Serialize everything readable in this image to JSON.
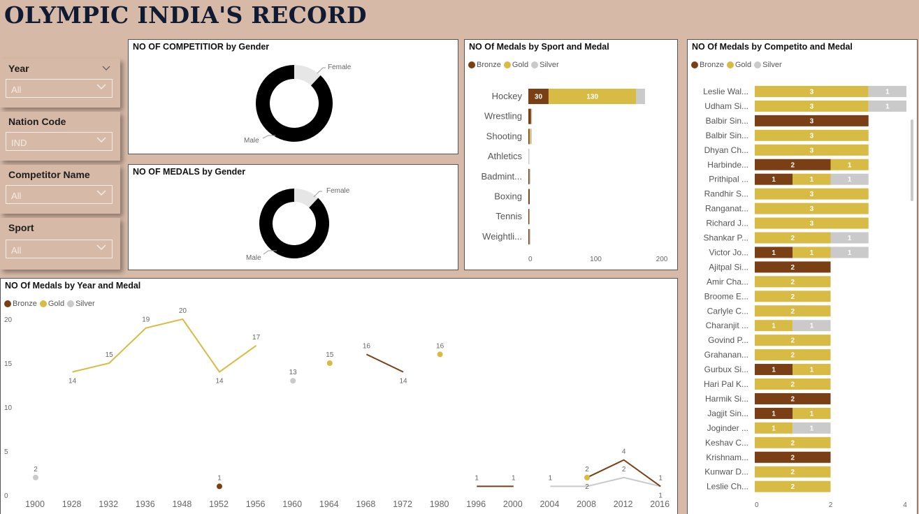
{
  "title": "OLYMPIC INDIA'S RECORD",
  "colors": {
    "bronze": "#7b3f15",
    "gold": "#d7bb45",
    "silver": "#cacaca",
    "male": "#000000",
    "female": "#e6e6e6"
  },
  "slicers": [
    {
      "label": "Year",
      "value": "All"
    },
    {
      "label": "Nation Code",
      "value": "IND"
    },
    {
      "label": "Competitor Name",
      "value": "All"
    },
    {
      "label": "Sport",
      "value": "All"
    }
  ],
  "legend": {
    "bronze": "Bronze",
    "gold": "Gold",
    "silver": "Silver"
  },
  "chart_data": [
    {
      "type": "pie",
      "title": "NO OF COMPETITIOR by Gender",
      "labels": [
        "Male",
        "Female"
      ],
      "values": [
        88,
        12
      ]
    },
    {
      "type": "pie",
      "title": "NO OF MEDALS by Gender",
      "labels": [
        "Male",
        "Female"
      ],
      "values": [
        88,
        12
      ]
    },
    {
      "type": "bar",
      "title": "NO Of Medals by Sport and Medal",
      "orientation": "horizontal",
      "categories": [
        "Hockey",
        "Wrestling",
        "Shooting",
        "Athletics",
        "Badmint...",
        "Boxing",
        "Tennis",
        "Weightli..."
      ],
      "series": [
        {
          "name": "Bronze",
          "values": [
            30,
            4,
            1,
            0,
            1,
            2,
            1,
            1
          ]
        },
        {
          "name": "Gold",
          "values": [
            130,
            0,
            1,
            0,
            0,
            0,
            0,
            0
          ]
        },
        {
          "name": "Silver",
          "values": [
            13,
            1,
            2,
            1,
            1,
            0,
            0,
            1
          ]
        }
      ],
      "xticks": [
        "0",
        "100",
        "200"
      ],
      "xlim": [
        0,
        200
      ]
    },
    {
      "type": "bar",
      "title": "NO Of Medals by Competito and Medal",
      "orientation": "horizontal",
      "categories": [
        "Leslie Wal...",
        "Udham Si...",
        "Balbir Sin...",
        "Balbir Sin...",
        "Dhyan Ch...",
        "Harbinde...",
        "Prithipal ...",
        "Randhir S...",
        "Ranganat...",
        "Richard J...",
        "Shankar P...",
        "Victor Jo...",
        "Ajitpal Si...",
        "Amir Cha...",
        "Broome E...",
        "Carlyle C...",
        "Charanjit ...",
        "Govind P...",
        "Grahanan...",
        "Gurbux Si...",
        "Hari Pal K...",
        "Harmik Si...",
        "Jagjit Sin...",
        "Joginder ...",
        "Keshav C...",
        "Krishnam...",
        "Kunwar D...",
        "Leslie Ch..."
      ],
      "series": [
        {
          "name": "Bronze",
          "values": [
            0,
            0,
            3,
            0,
            0,
            2,
            1,
            0,
            0,
            0,
            0,
            1,
            2,
            0,
            0,
            0,
            0,
            0,
            0,
            1,
            0,
            2,
            1,
            0,
            0,
            2,
            0,
            0
          ]
        },
        {
          "name": "Gold",
          "values": [
            3,
            3,
            0,
            3,
            3,
            1,
            1,
            3,
            3,
            3,
            2,
            1,
            0,
            2,
            2,
            2,
            1,
            2,
            2,
            1,
            2,
            0,
            1,
            1,
            2,
            0,
            2,
            2
          ]
        },
        {
          "name": "Silver",
          "values": [
            1,
            1,
            0,
            0,
            0,
            0,
            1,
            0,
            0,
            0,
            1,
            1,
            0,
            0,
            0,
            0,
            1,
            0,
            0,
            0,
            0,
            0,
            0,
            1,
            0,
            0,
            0,
            0
          ]
        }
      ],
      "xticks": [
        "0",
        "2",
        "4"
      ],
      "xlim": [
        0,
        4
      ]
    },
    {
      "type": "line",
      "title": "NO Of Medals by Year and Medal",
      "x": [
        "1900",
        "1928",
        "1932",
        "1936",
        "1948",
        "1952",
        "1956",
        "1960",
        "1964",
        "1968",
        "1972",
        "1980",
        "1996",
        "2000",
        "2004",
        "2008",
        "2012",
        "2016"
      ],
      "series": [
        {
          "name": "Bronze",
          "values": [
            null,
            null,
            null,
            null,
            null,
            1,
            null,
            null,
            null,
            16,
            14,
            null,
            1,
            1,
            null,
            2,
            4,
            1
          ]
        },
        {
          "name": "Gold",
          "values": [
            null,
            14,
            15,
            19,
            20,
            14,
            17,
            null,
            15,
            null,
            null,
            16,
            null,
            null,
            null,
            2,
            null,
            null
          ]
        },
        {
          "name": "Silver",
          "values": [
            2,
            null,
            null,
            null,
            null,
            null,
            null,
            13,
            null,
            null,
            null,
            null,
            null,
            null,
            1,
            1,
            2,
            1
          ]
        }
      ],
      "yticks": [
        "0",
        "5",
        "10",
        "15",
        "20"
      ],
      "ylim": [
        0,
        21
      ]
    }
  ]
}
